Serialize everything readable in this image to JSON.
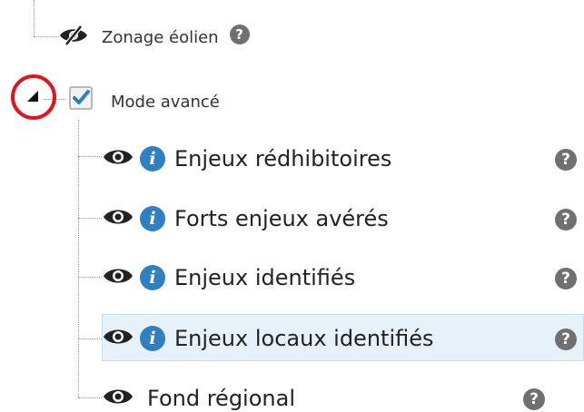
{
  "tree": {
    "items": [
      {
        "label": "Zonage éolien",
        "visible": false,
        "level": 0
      },
      {
        "label": "Mode avancé",
        "checked": true,
        "expanded": true,
        "level": 0
      },
      {
        "label": "Enjeux rédhibitoires",
        "visible": true,
        "info": "i",
        "level": 1
      },
      {
        "label": "Forts enjeux avérés",
        "visible": true,
        "info": "i",
        "level": 1
      },
      {
        "label": "Enjeux identifiés",
        "visible": true,
        "info": "i",
        "level": 1
      },
      {
        "label": "Enjeux locaux identifiés",
        "visible": true,
        "info": "i",
        "level": 1,
        "selected": true
      },
      {
        "label": "Fond régional",
        "visible": true,
        "level": 1
      }
    ],
    "help_glyph": "?",
    "info_glyph": "i"
  },
  "colors": {
    "info": "#2f7fc1",
    "help": "#707070",
    "check": "#2f7fc1",
    "highlight": "#e6f1f9",
    "annotation": "#e0141e"
  }
}
